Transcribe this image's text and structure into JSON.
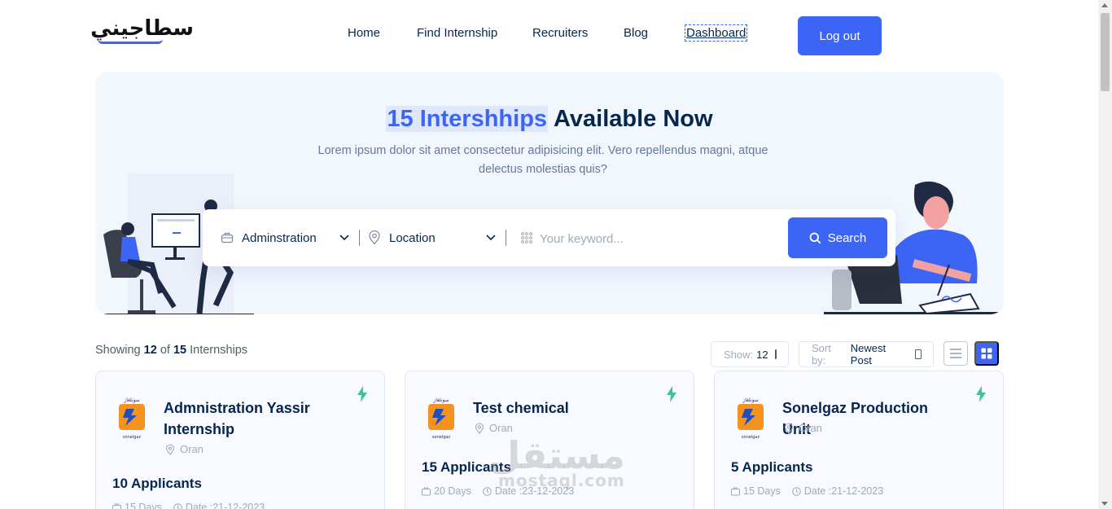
{
  "brand": {
    "logo_text": "سطاجيني"
  },
  "nav": {
    "items": [
      {
        "label": "Home"
      },
      {
        "label": "Find Internship"
      },
      {
        "label": "Recruiters"
      },
      {
        "label": "Blog"
      },
      {
        "label": "Dashboard"
      }
    ],
    "logout_label": "Log out"
  },
  "hero": {
    "title_highlight": "15 Intershhips",
    "title_rest": "Available Now",
    "subtitle": "Lorem ipsum dolor sit amet consectetur adipisicing elit. Vero repellendus magni, atque delectus molestias quis?"
  },
  "search": {
    "category": "Adminstration",
    "location": "Location",
    "keyword_placeholder": "Your keyword...",
    "button_label": "Search"
  },
  "listing": {
    "showing_prefix": "Showing",
    "shown": "12",
    "of": "of",
    "total": "15",
    "suffix": "Internships",
    "show_label": "Show:",
    "show_value": "12",
    "sort_label": "Sort by:",
    "sort_value": "Newest Post"
  },
  "cards": [
    {
      "title": "Admnistration Yassir Internship",
      "location": "Oran",
      "applicants": "10 Applicants",
      "duration": "15 Days",
      "date": "Date :21-12-2023"
    },
    {
      "title": "Test chemical",
      "location": "Oran",
      "applicants": "15 Applicants",
      "duration": "20 Days",
      "date": "Date :23-12-2023"
    },
    {
      "title": "Sonelgaz Production Unit",
      "location": "Oran",
      "applicants": "5 Applicants",
      "duration": "15 Days",
      "date": "Date :21-12-2023"
    }
  ],
  "company_logo": {
    "top_text": "سونلغاز",
    "bottom_text": "sonelgaz"
  },
  "watermark": {
    "arabic": "مستقل",
    "latin": "mostaql.com"
  },
  "colors": {
    "accent": "#3c65f5",
    "heading": "#05264e",
    "muted": "#a0abb8",
    "bolt": "#3ec29a",
    "logo_orange": "#f5931e"
  }
}
